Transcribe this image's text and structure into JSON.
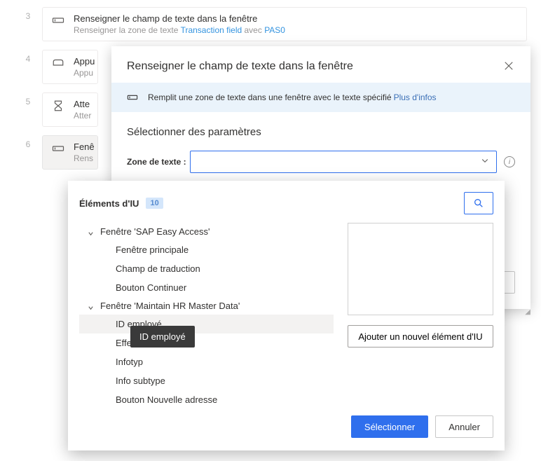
{
  "flow": {
    "steps": [
      {
        "num": "3",
        "title": "Renseigner le champ de texte dans la fenêtre",
        "sub_pre": "Renseigner la zone de texte ",
        "sub_link1": "Transaction field",
        "sub_mid": " avec ",
        "sub_link2": "PAS0"
      },
      {
        "num": "4",
        "title": "Appu",
        "sub_pre": "Appu"
      },
      {
        "num": "5",
        "title": "Atte",
        "sub_pre": "Atter"
      },
      {
        "num": "6",
        "title": "Fenê",
        "sub_pre": "Rens"
      }
    ]
  },
  "dialog": {
    "title": "Renseigner le champ de texte dans la fenêtre",
    "info_text": "Remplit une zone de texte dans une fenêtre avec le texte spécifié",
    "info_link": "Plus d'infos",
    "section_label": "Sélectionner des paramètres",
    "field_label": "Zone de texte :",
    "select_btn": "Sélectionner",
    "cancel_btn": "Annuler"
  },
  "popover": {
    "heading": "Éléments d'IU",
    "badge": "10",
    "add_btn": "Ajouter un nouvel élément d'IU",
    "select_btn": "Sélectionner",
    "cancel_btn": "Annuler",
    "tree": {
      "group1": "Fenêtre 'SAP Easy Access'",
      "g1_items": [
        "Fenêtre principale",
        "Champ de traduction",
        "Bouton Continuer"
      ],
      "group2": "Fenêtre 'Maintain HR Master Data'",
      "g2_items": [
        "ID employé",
        "Effecti",
        "Infotyp",
        "Info subtype",
        "Bouton Nouvelle adresse"
      ]
    }
  },
  "tooltip": "ID employé"
}
